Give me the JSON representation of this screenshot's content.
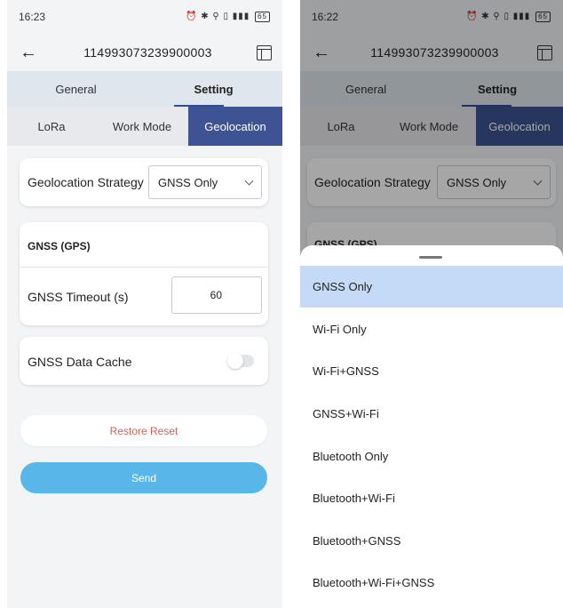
{
  "status_left": {
    "time": "16:23",
    "icons": "⏰ ✱ ⚲ ▯ ▮▮▮",
    "battery": "65"
  },
  "status_right": {
    "time": "16:22",
    "icons": "⏰ ✱ ⚲ ▯ ▮▮▮",
    "battery": "65"
  },
  "header": {
    "device_id": "114993073239900003"
  },
  "tabs": [
    "General",
    "Setting"
  ],
  "subtabs": [
    "LoRa",
    "Work Mode",
    "Geolocation"
  ],
  "geolocation": {
    "strategy_label": "Geolocation Strategy",
    "strategy_value": "GNSS Only"
  },
  "gnss": {
    "section_title": "GNSS (GPS)",
    "timeout_label": "GNSS Timeout (s)",
    "timeout_value": "60",
    "cache_label": "GNSS Data Cache",
    "cache_enabled": false
  },
  "buttons": {
    "restore": "Restore Reset",
    "send": "Send"
  },
  "dropdown": {
    "partial_heading": "GNSS (GPS)",
    "options": [
      "GNSS Only",
      "Wi-Fi Only",
      "Wi-Fi+GNSS",
      "GNSS+Wi-Fi",
      "Bluetooth Only",
      "Bluetooth+Wi-Fi",
      "Bluetooth+GNSS",
      "Bluetooth+Wi-Fi+GNSS"
    ],
    "selected": "GNSS Only"
  },
  "colors": {
    "accent": "#3d5393",
    "send": "#58b6e8",
    "restore_text": "#d55e52",
    "selected_option": "#c5daf7"
  }
}
